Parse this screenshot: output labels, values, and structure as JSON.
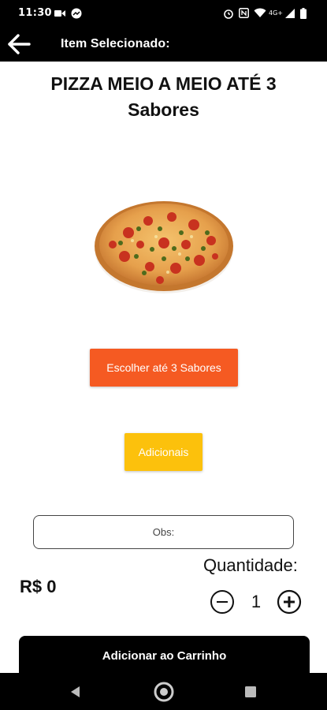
{
  "status_bar": {
    "time": "11:30",
    "network": "4G+"
  },
  "toolbar": {
    "back_icon": "arrow-back-icon",
    "title": "Item Selecionado:"
  },
  "product": {
    "title": "PIZZA MEIO A MEIO ATÉ  3 Sabores",
    "image": "pizza-image"
  },
  "buttons": {
    "choose_flavors": "Escolher até 3 Sabores",
    "extras": "Adicionais",
    "add_to_cart": "Adicionar ao Carrinho"
  },
  "obs": {
    "placeholder": "Obs:",
    "value": ""
  },
  "quantity": {
    "label": "Quantidade:",
    "value": "1",
    "minus_icon": "minus-circle-icon",
    "plus_icon": "plus-circle-icon"
  },
  "price": "R$ 0",
  "colors": {
    "bar": "#000000",
    "choose_flavors_button": "#f55a22",
    "extras_button": "#fcc10c",
    "cart_button": "#000000"
  }
}
